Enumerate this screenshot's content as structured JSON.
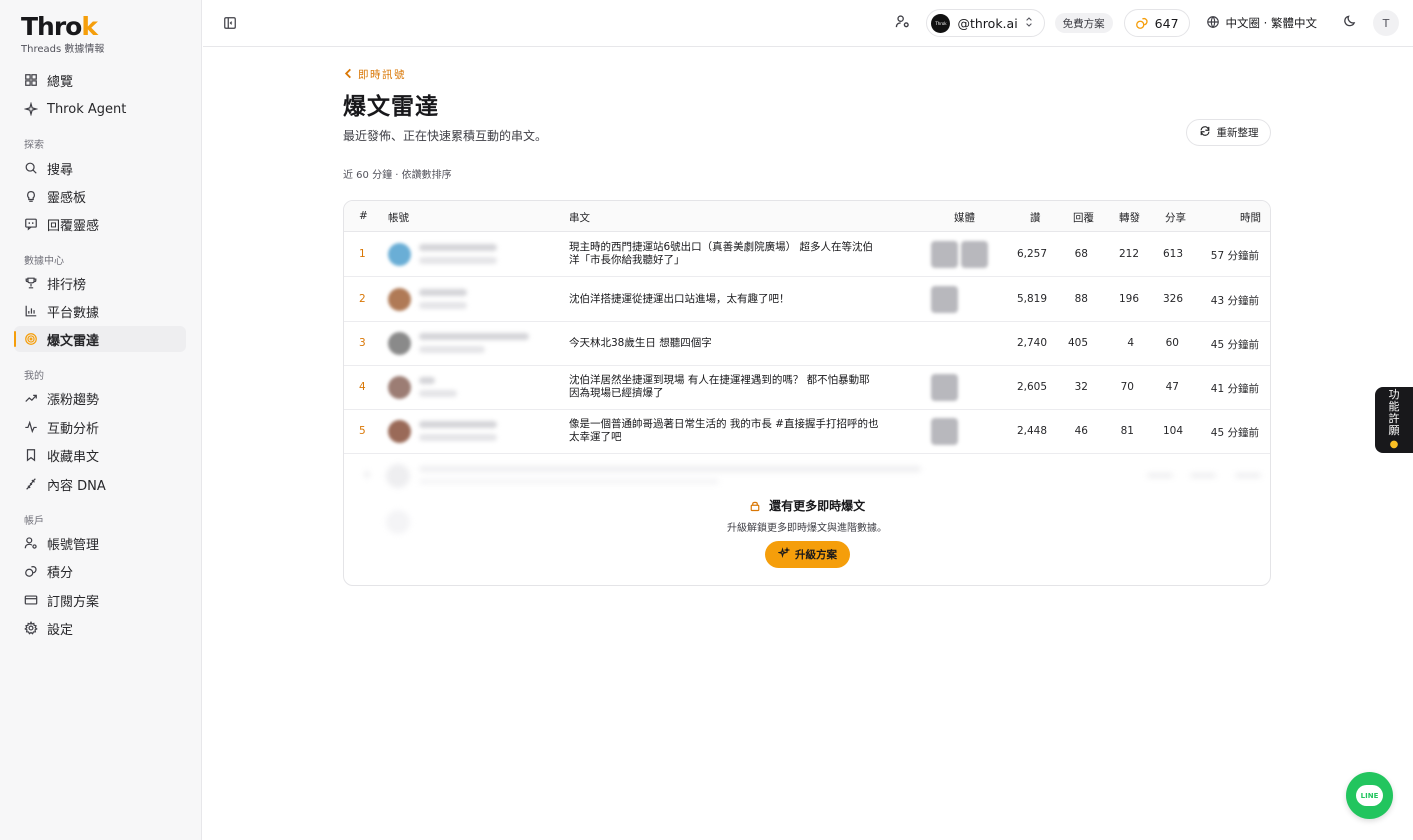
{
  "brand": {
    "name_main": "Thro",
    "name_accent": "k",
    "subtitle": "Threads 數據情報"
  },
  "sidebar": {
    "items_top": [
      {
        "label": "總覽",
        "icon": "grid-icon"
      },
      {
        "label": "Throk Agent",
        "icon": "sparkle-icon"
      }
    ],
    "section_explore": "探索",
    "items_explore": [
      {
        "label": "搜尋",
        "icon": "search-icon"
      },
      {
        "label": "靈感板",
        "icon": "lightbulb-icon"
      },
      {
        "label": "回覆靈感",
        "icon": "reply-icon"
      }
    ],
    "section_data": "數據中心",
    "items_data": [
      {
        "label": "排行榜",
        "icon": "trophy-icon"
      },
      {
        "label": "平台數據",
        "icon": "bar-chart-icon"
      },
      {
        "label": "爆文雷達",
        "icon": "radar-icon",
        "active": true
      }
    ],
    "section_mine": "我的",
    "items_mine": [
      {
        "label": "漲粉趨勢",
        "icon": "trending-up-icon"
      },
      {
        "label": "互動分析",
        "icon": "activity-icon"
      },
      {
        "label": "收藏串文",
        "icon": "bookmark-icon"
      },
      {
        "label": "內容 DNA",
        "icon": "dna-icon"
      }
    ],
    "section_account": "帳戶",
    "items_account": [
      {
        "label": "帳號管理",
        "icon": "user-cog-icon"
      },
      {
        "label": "積分",
        "icon": "coins-icon"
      },
      {
        "label": "訂閱方案",
        "icon": "credit-card-icon"
      },
      {
        "label": "設定",
        "icon": "gear-icon"
      }
    ]
  },
  "topbar": {
    "account_handle": "@throk.ai",
    "account_avatar_text": "Throk",
    "plan": "免費方案",
    "points": "647",
    "language": "中文圈 · 繁體中文",
    "user_initial": "T"
  },
  "page": {
    "back_label": "即時訊號",
    "title": "爆文雷達",
    "description": "最近發佈、正在快速累積互動的串文。",
    "refresh_label": "重新整理",
    "filter_note": "近 60 分鐘 · 依讚數排序"
  },
  "table": {
    "headers": {
      "rank": "#",
      "account": "帳號",
      "post": "串文",
      "media": "媒體",
      "likes": "讚",
      "replies": "回覆",
      "reposts": "轉發",
      "shares": "分享",
      "time": "時間"
    },
    "rows": [
      {
        "rank": "1",
        "text": "現主時的西門捷運站6號出口（真善美劇院廣場） 超多人在等沈伯洋「市長你給我聽好了」",
        "likes": "6,257",
        "replies": "68",
        "reposts": "212",
        "shares": "613",
        "time": "57 分鐘前",
        "media_count": 2,
        "avatar_color": "#6aaed6"
      },
      {
        "rank": "2",
        "text": "沈伯洋搭捷運從捷運出口站進場，太有趣了吧！",
        "likes": "5,819",
        "replies": "88",
        "reposts": "196",
        "shares": "326",
        "time": "43 分鐘前",
        "media_count": 1,
        "avatar_color": "#b07a56"
      },
      {
        "rank": "3",
        "text": "今天林北38歲生日 想聽四個字",
        "likes": "2,740",
        "replies": "405",
        "reposts": "4",
        "shares": "60",
        "time": "45 分鐘前",
        "media_count": 0,
        "avatar_color": "#8a8a8a"
      },
      {
        "rank": "4",
        "text": "沈伯洋居然坐捷運到現場 有人在捷運裡遇到的嗎？ 都不怕暴動耶 因為現場已經擠爆了",
        "likes": "2,605",
        "replies": "32",
        "reposts": "70",
        "shares": "47",
        "time": "41 分鐘前",
        "media_count": 1,
        "avatar_color": "#9c7d74"
      },
      {
        "rank": "5",
        "text": "像是一個普通帥哥過著日常生活的 我的市長 #直接握手打招呼的也太幸運了吧",
        "likes": "2,448",
        "replies": "46",
        "reposts": "81",
        "shares": "104",
        "time": "45 分鐘前",
        "media_count": 1,
        "avatar_color": "#9a6a58"
      }
    ]
  },
  "locked": {
    "title": "還有更多即時爆文",
    "subtitle": "升級解鎖更多即時爆文與進階數據。",
    "button": "升級方案"
  },
  "feature_tab": {
    "label": "功能許願"
  },
  "line_button": {
    "label": "LINE"
  }
}
